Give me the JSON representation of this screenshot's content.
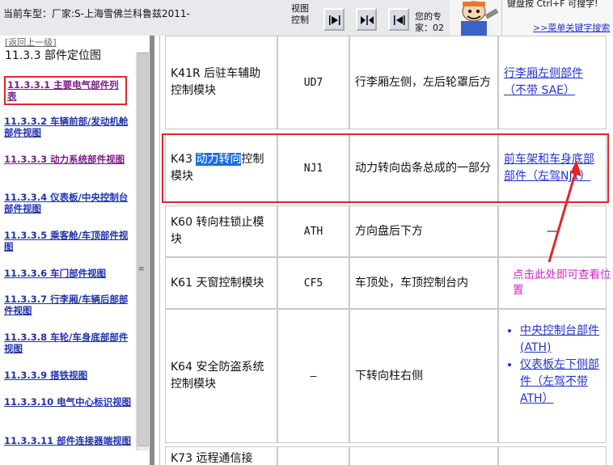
{
  "header": {
    "vehicle": "当前车型：厂家:S-上海雪佛兰科鲁兹2011-",
    "view_control_line1": "视图",
    "view_control_line2": "控制",
    "expert_text": "您的专家：02",
    "search_hint": "键盘按 Ctrl+F 可搜字!",
    "search_link": ">>菜单关键字搜索"
  },
  "sidebar": {
    "back_link": "[返回上一级]",
    "section_title": "11.3.3 部件定位图",
    "items": [
      {
        "label": "11.3.3.1 主要电气部件列表"
      },
      {
        "label": "11.3.3.2 车辆前部/发动机舱部件视图"
      },
      {
        "label": "11.3.3.3 动力系统部件视图"
      },
      {
        "label": "11.3.3.4 仪表板/中央控制台部件视图"
      },
      {
        "label": "11.3.3.5 乘客舱/车顶部件视图"
      },
      {
        "label": "11.3.3.6 车门部件视图"
      },
      {
        "label": "11.3.3.7 行李厢/车辆后部部件视图"
      },
      {
        "label": "11.3.3.8 车轮/车身底部部件视图"
      },
      {
        "label": "11.3.3.9 搭铁视图"
      },
      {
        "label": "11.3.3.10 电气中心标识视图"
      },
      {
        "label": "11.3.3.11 部件连接器端视图"
      }
    ]
  },
  "table": {
    "rows": [
      {
        "component": "K41R 后驻车辅助控制模块",
        "code": "UD7",
        "location": "行李厢左侧，左后轮罩后方",
        "refs": [
          "行李厢左侧部件（不带 SAE）"
        ]
      },
      {
        "component_prefix": "K43 ",
        "component_selected": "动力转向",
        "component_suffix": "控制模块",
        "code": "NJ1",
        "location": "动力转向齿条总成的一部分",
        "refs": [
          "前车架和车身底部部件（左驾NJ1）"
        ]
      },
      {
        "component": "K60 转向柱锁止模块",
        "code": "ATH",
        "location": "方向盘后下方",
        "refs": [
          "—"
        ]
      },
      {
        "component": "K61 天窗控制模块",
        "code": "CF5",
        "location": "车顶处，车顶控制台内",
        "refs": []
      },
      {
        "component": "K64 安全防盗系统控制模块",
        "code": "—",
        "location": "下转向柱右侧",
        "refs": [
          "中央控制台部件 (ATH)",
          "仪表板左下侧部件（左驾不带ATH）"
        ]
      },
      {
        "component": "K73 远程通信接",
        "code": "",
        "location": "",
        "refs": []
      }
    ]
  },
  "annotation": "点击此处即可查看位置",
  "colors": {
    "highlight": "#e0262a",
    "annotation": "#d026c8",
    "link": "#2233cc",
    "selection": "#1e6fd6"
  }
}
